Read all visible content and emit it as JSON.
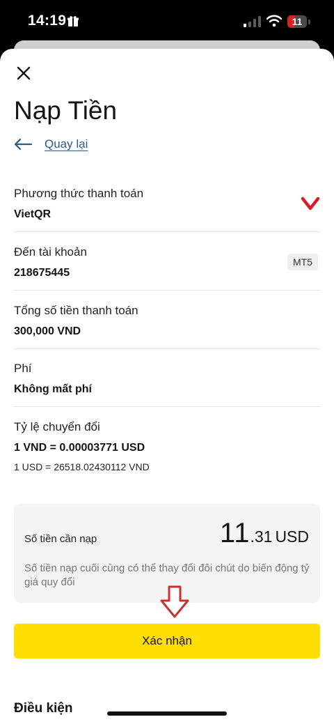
{
  "status_bar": {
    "time": "14:19",
    "battery": "11",
    "icons": [
      "gift-icon",
      "signal-icon",
      "wifi-icon",
      "battery-icon"
    ]
  },
  "header": {
    "title": "Nạp Tiền",
    "back_label": "Quay lại",
    "icons": [
      "close-icon",
      "arrow-left-icon"
    ]
  },
  "details": {
    "payment_method": {
      "label": "Phương thức thanh toán",
      "value": "VietQR"
    },
    "account": {
      "label": "Đến tài khoản",
      "value": "218675445",
      "badge": "MT5"
    },
    "total": {
      "label": "Tổng số tiền thanh toán",
      "value": "300,000 VND"
    },
    "fee": {
      "label": "Phí",
      "value": "Không mất phí"
    },
    "rate": {
      "label": "Tỷ lệ chuyển đổi",
      "value": "1 VND = 0.00003771 USD",
      "sub": "1 USD = 26518.02430112 VND"
    }
  },
  "amount_card": {
    "label": "Số tiền cần nạp",
    "amount_int": "11",
    "amount_dec": ".31",
    "currency": "USD",
    "note": "Số tiền nạp cuối cùng có thể thay đổi đôi chút do biến động tỷ giá quy đổi"
  },
  "confirm_label": "Xác nhận",
  "terms_heading": "Điều kiện",
  "colors": {
    "accent_yellow": "#ffde02",
    "link_blue": "#2b5d8a",
    "chevron_red": "#d81b27",
    "annotation_red": "#c8322f"
  }
}
